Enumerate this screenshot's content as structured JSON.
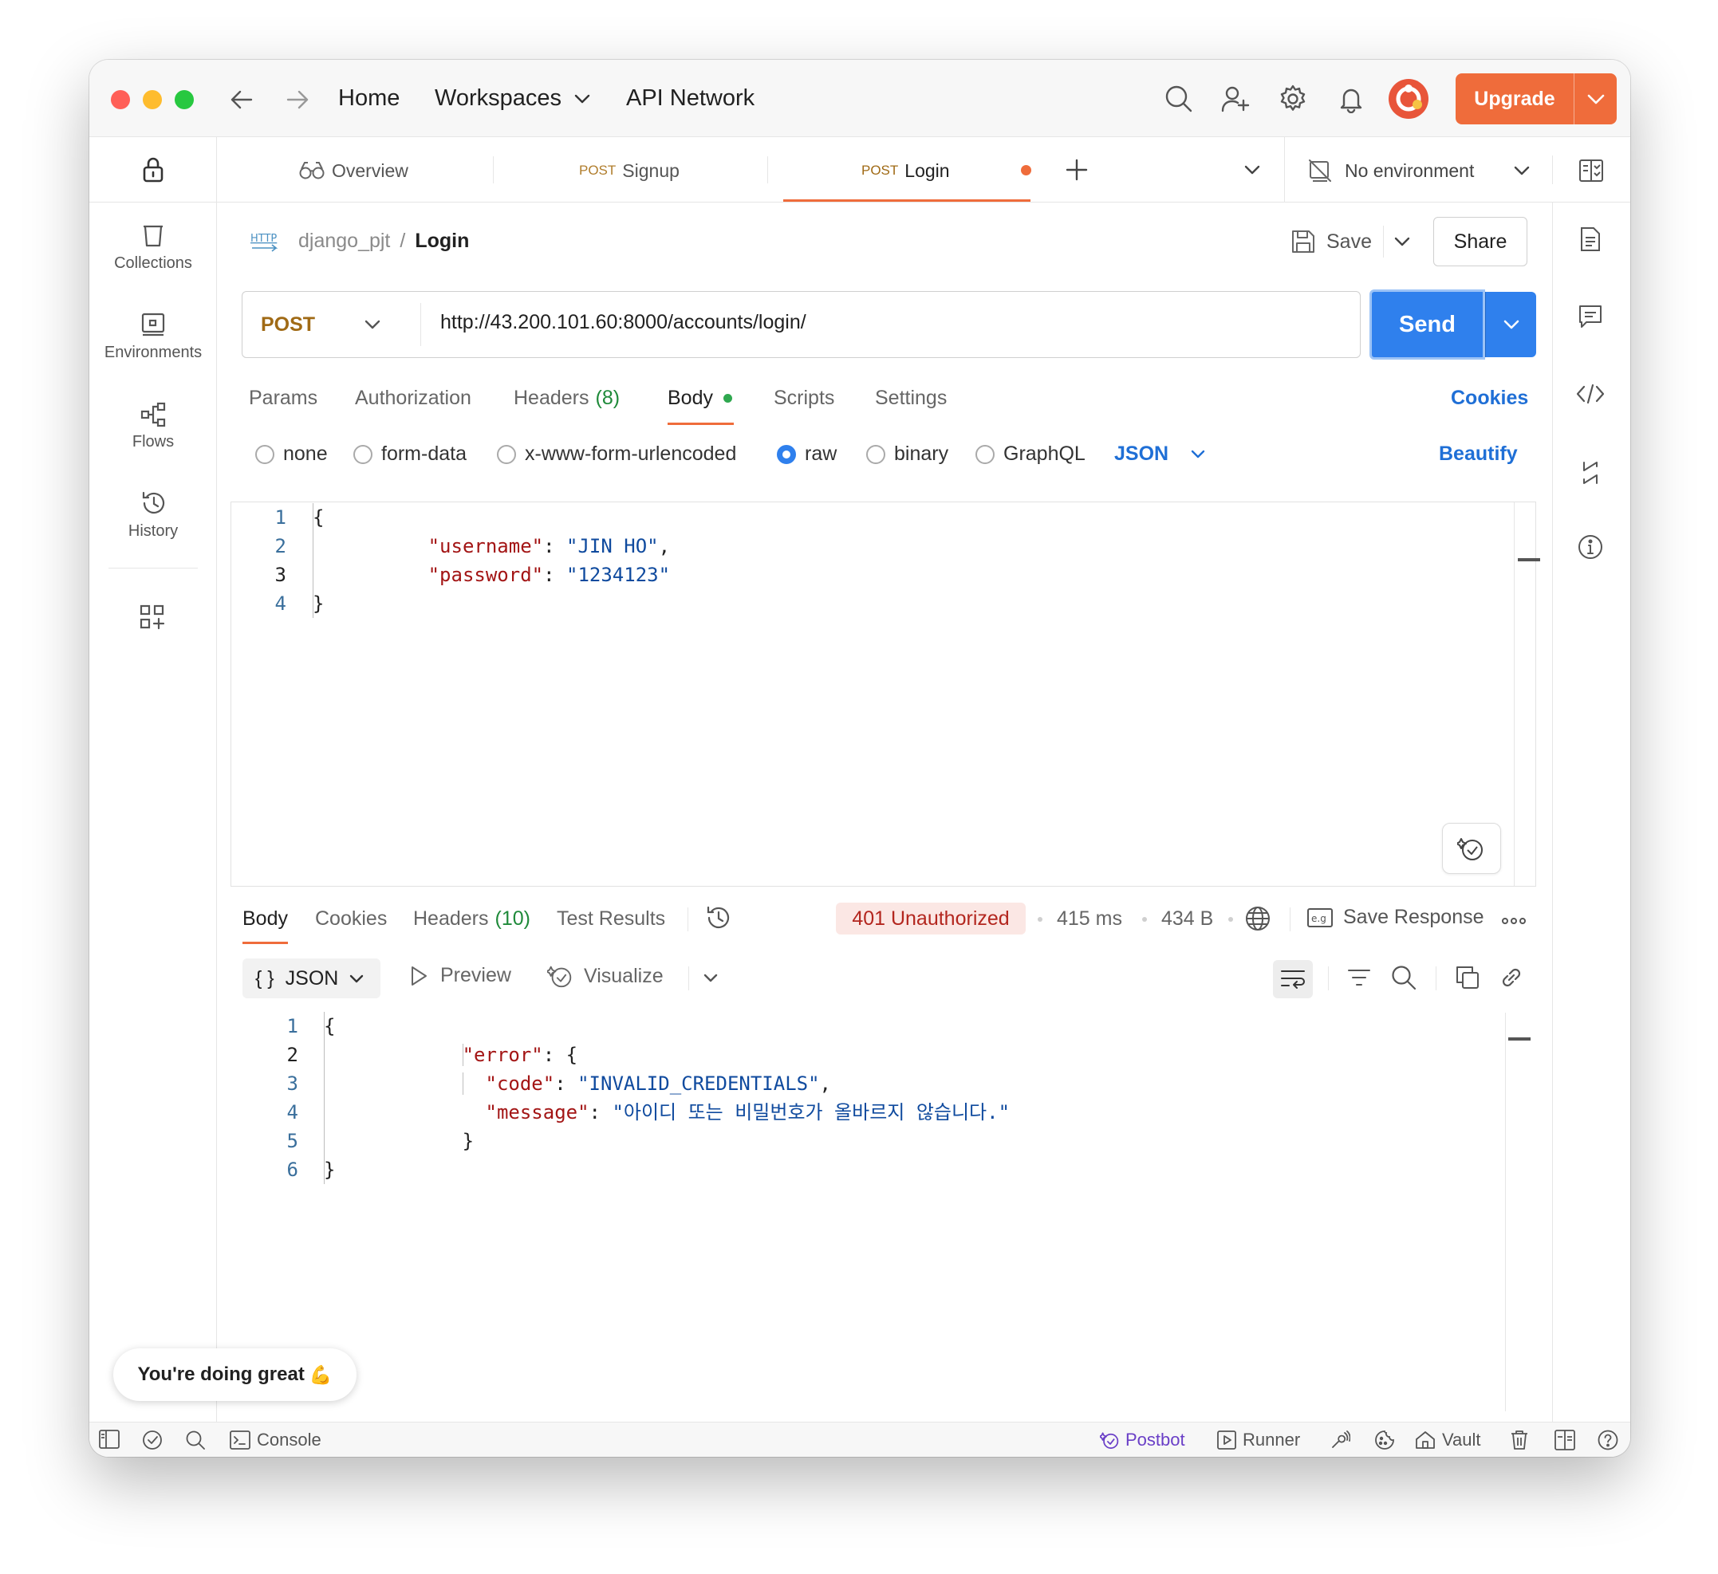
{
  "titlebar": {
    "nav": [
      "Home",
      "Workspaces",
      "API Network"
    ],
    "upgrade_label": "Upgrade",
    "colors": {
      "close": "#ff5f57",
      "minimize": "#febc2e",
      "zoom": "#28c840",
      "upgrade": "#ef6c3b",
      "accent": "#2f80ed"
    }
  },
  "sidebar": {
    "items": [
      {
        "label": "Collections",
        "icon": "trash-can-icon"
      },
      {
        "label": "Environments",
        "icon": "environment-icon"
      },
      {
        "label": "Flows",
        "icon": "flows-icon"
      },
      {
        "label": "History",
        "icon": "history-icon"
      }
    ]
  },
  "tabs": {
    "overview": "Overview",
    "items": [
      {
        "method": "POST",
        "name": "Signup"
      },
      {
        "method": "POST",
        "name": "Login"
      }
    ],
    "environment": "No environment"
  },
  "request": {
    "breadcrumb_parent": "django_pjt",
    "breadcrumb_sep": "/",
    "breadcrumb_current": "Login",
    "save_label": "Save",
    "share_label": "Share",
    "method": "POST",
    "url": "http://43.200.101.60:8000/accounts/login/",
    "send_label": "Send",
    "subtabs": {
      "params": "Params",
      "authorization": "Authorization",
      "headers": "Headers",
      "headers_count": "(8)",
      "body": "Body",
      "scripts": "Scripts",
      "settings": "Settings",
      "cookies": "Cookies"
    },
    "body_types": [
      "none",
      "form-data",
      "x-www-form-urlencoded",
      "raw",
      "binary",
      "GraphQL"
    ],
    "selected_body_type": "raw",
    "format": "JSON",
    "beautify": "Beautify",
    "code_lines": [
      {
        "num": "1",
        "text": "{"
      },
      {
        "num": "2",
        "key": "\"username\"",
        "colon": ": ",
        "value": "\"JIN HO\"",
        "tail": ","
      },
      {
        "num": "3",
        "key": "\"password\"",
        "colon": ": ",
        "value": "\"1234123\"",
        "tail": ""
      },
      {
        "num": "4",
        "text": "}"
      }
    ]
  },
  "response": {
    "tabs": {
      "body": "Body",
      "cookies": "Cookies",
      "headers": "Headers",
      "headers_count": "(10)",
      "test_results": "Test Results"
    },
    "status": "401 Unauthorized",
    "time": "415 ms",
    "size": "434 B",
    "save_response": "Save Response",
    "format": "JSON",
    "format_braces": "{ }",
    "preview": "Preview",
    "visualize": "Visualize",
    "lines": {
      "n1": "1",
      "n2": "2",
      "n3": "3",
      "n4": "4",
      "n5": "5",
      "n6": "6",
      "open": "{",
      "error_key": "\"error\"",
      "error_open": ": {",
      "code_key": "\"code\"",
      "code_val": "\"INVALID_CREDENTIALS\"",
      "message_key": "\"message\"",
      "message_val": "\"아이디 또는 비밀번호가 올바르지 않습니다.\"",
      "colon": ": ",
      "comma": ",",
      "inner_close": "}",
      "close": "}"
    }
  },
  "toast": {
    "text": "You're doing great",
    "emoji": "💪"
  },
  "statusbar": {
    "console": "Console",
    "postbot": "Postbot",
    "runner": "Runner",
    "vault": "Vault"
  }
}
